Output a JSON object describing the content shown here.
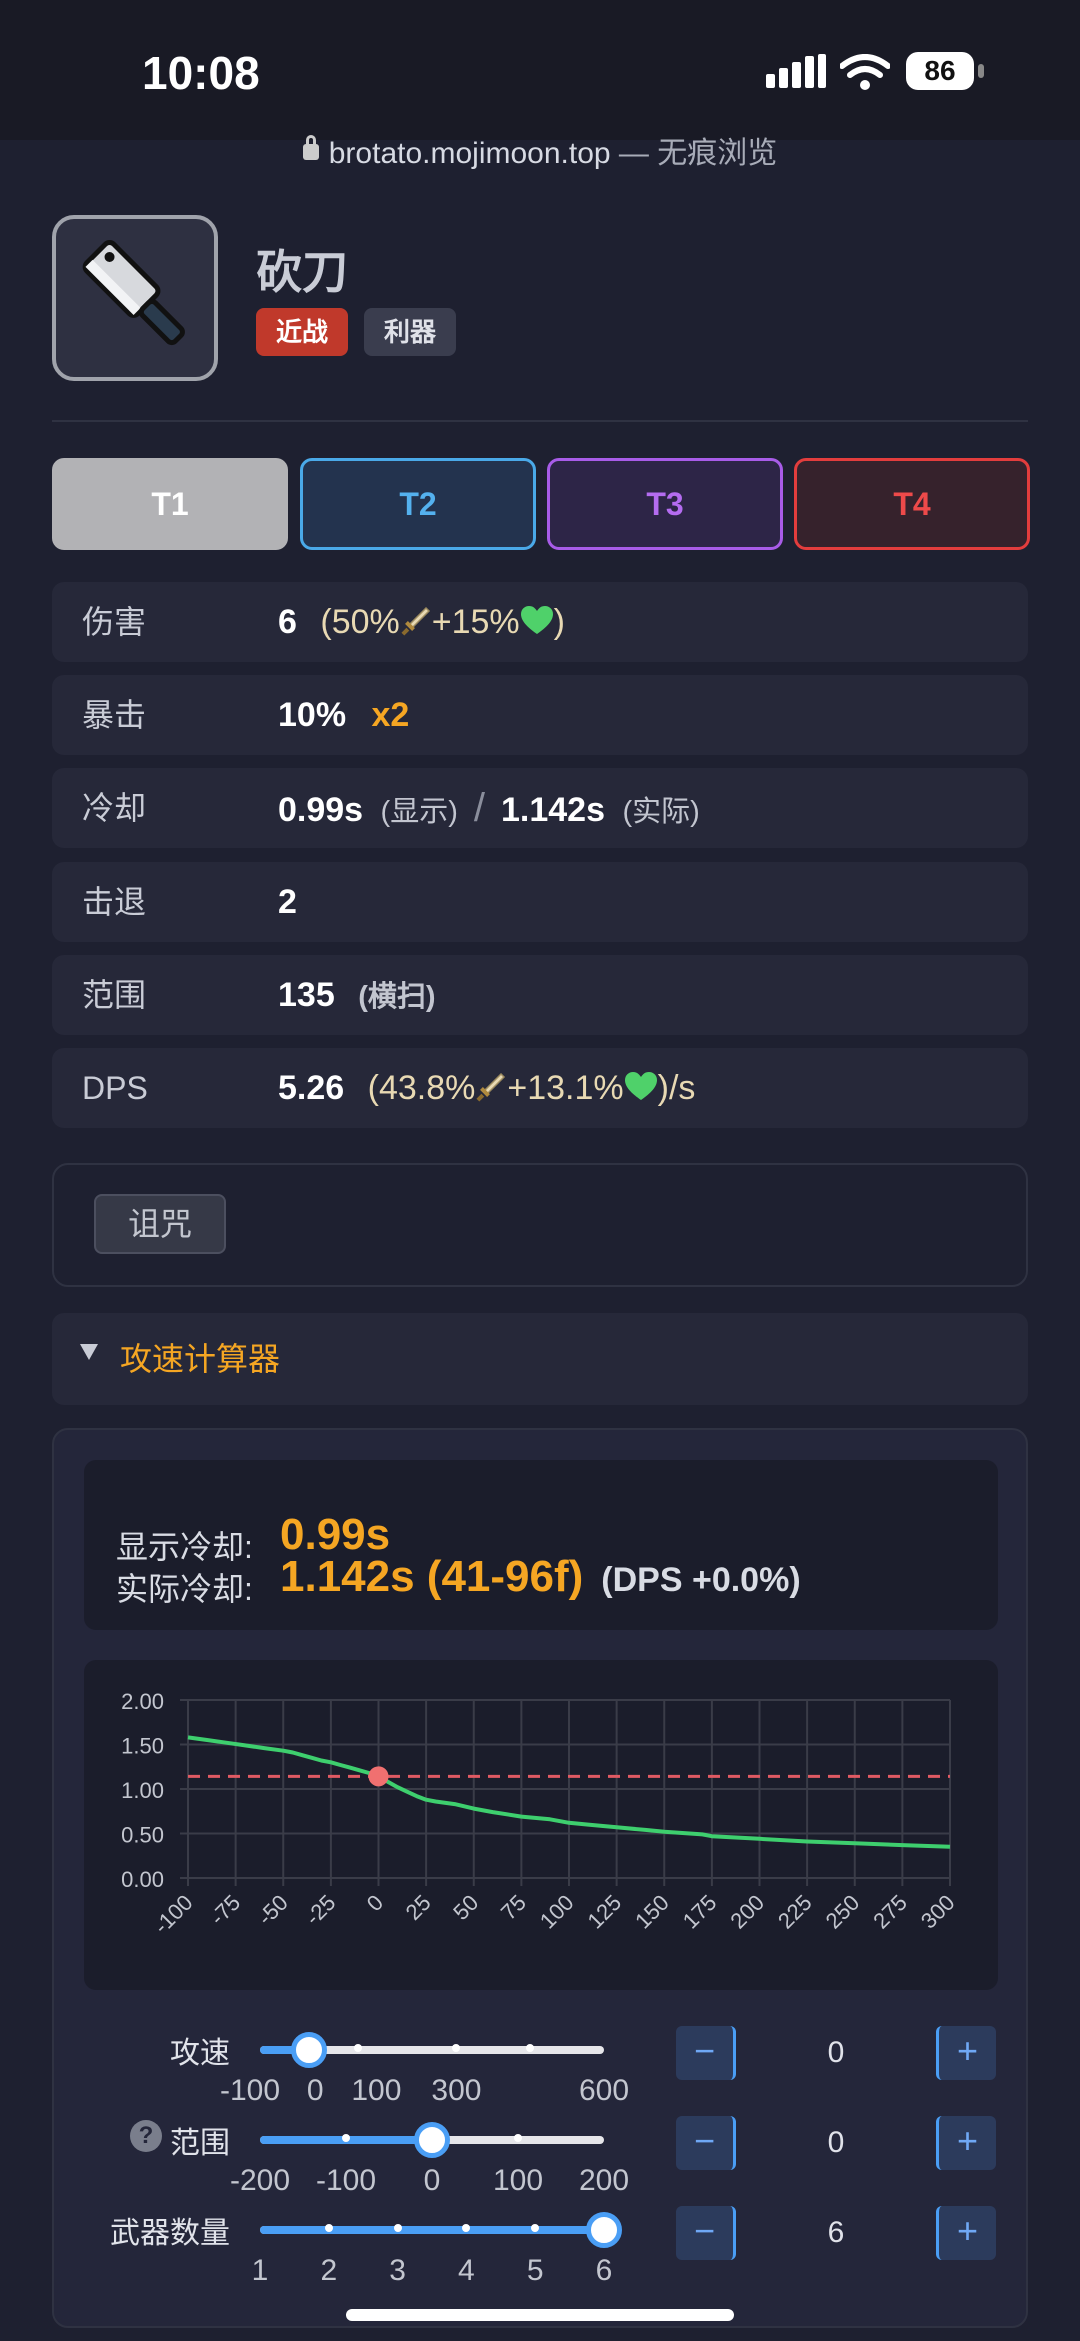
{
  "status": {
    "time": "10:08",
    "battery": "86"
  },
  "browser": {
    "url": "brotato.mojimoon.top",
    "suffix": " — 无痕浏览"
  },
  "weapon": {
    "name": "砍刀",
    "tags": [
      "近战",
      "利器"
    ]
  },
  "tiers": [
    "T1",
    "T2",
    "T3",
    "T4"
  ],
  "stats": {
    "damage": {
      "label": "伤害",
      "value": "6",
      "open": "(50%",
      "plus": "+15%",
      "close": ")"
    },
    "crit": {
      "label": "暴击",
      "value": "10%",
      "mult": "x2"
    },
    "cooldown": {
      "label": "冷却",
      "shown": "0.99s",
      "shown_note": "(显示)",
      "sep": "/",
      "actual": "1.142s",
      "actual_note": "(实际)"
    },
    "knockback": {
      "label": "击退",
      "value": "2"
    },
    "range": {
      "label": "范围",
      "value": "135",
      "note": "(横扫)"
    },
    "dps": {
      "label": "DPS",
      "value": "5.26",
      "open": "(43.8%",
      "plus": "+13.1%",
      "close": ")/s"
    }
  },
  "curse": {
    "label": "诅咒"
  },
  "calculator": {
    "title": "攻速计算器",
    "shown_label": "显示冷却:",
    "shown_value": "0.99s",
    "actual_label": "实际冷却:",
    "actual_value": "1.142s (41-96f)",
    "dps_delta": "(DPS +0.0%)"
  },
  "chart_data": {
    "type": "line",
    "x_ticks": [
      "-100",
      "-75",
      "-50",
      "-25",
      "0",
      "25",
      "50",
      "75",
      "100",
      "125",
      "150",
      "175",
      "200",
      "225",
      "250",
      "275",
      "300"
    ],
    "y_ticks": [
      "2.00",
      "1.50",
      "1.00",
      "0.50",
      "0.00"
    ],
    "xlim": [
      -100,
      300
    ],
    "ylim": [
      0,
      2
    ],
    "grid": true,
    "series_color": "#3ecf6e",
    "reference_line": {
      "y": 1.142,
      "color": "#e05a63"
    },
    "marker": {
      "x": 0,
      "y": 1.142,
      "color": "#f07070"
    },
    "x": [
      -100,
      -90,
      -80,
      -70,
      -60,
      -50,
      -45,
      -40,
      -35,
      -30,
      -25,
      -20,
      -15,
      -10,
      -5,
      0,
      5,
      10,
      15,
      20,
      25,
      30,
      40,
      50,
      60,
      75,
      90,
      100,
      110,
      125,
      140,
      150,
      170,
      175,
      200,
      225,
      250,
      275,
      300
    ],
    "y": [
      1.58,
      1.55,
      1.52,
      1.49,
      1.46,
      1.43,
      1.41,
      1.38,
      1.35,
      1.32,
      1.3,
      1.27,
      1.24,
      1.21,
      1.18,
      1.142,
      1.08,
      1.02,
      0.97,
      0.92,
      0.88,
      0.86,
      0.83,
      0.78,
      0.74,
      0.69,
      0.66,
      0.62,
      0.6,
      0.57,
      0.54,
      0.52,
      0.49,
      0.47,
      0.44,
      0.41,
      0.39,
      0.37,
      0.35
    ]
  },
  "sliders": {
    "attack_speed": {
      "label": "攻速",
      "value": "0",
      "fraction": 0.143,
      "ticks": [
        "-100",
        "0",
        "100",
        "300",
        "600"
      ],
      "dots": [
        0.286,
        0.571,
        0.786
      ]
    },
    "range": {
      "label": "范围",
      "help": "?",
      "value": "0",
      "fraction": 0.5,
      "ticks": [
        "-200",
        "-100",
        "0",
        "100",
        "200"
      ],
      "dots": [
        0.25,
        0.75
      ]
    },
    "weapon_count": {
      "label": "武器数量",
      "value": "6",
      "fraction": 1.0,
      "ticks": [
        "1",
        "2",
        "3",
        "4",
        "5",
        "6"
      ],
      "dots": [
        0.2,
        0.4,
        0.6,
        0.8
      ]
    }
  },
  "stepper": {
    "minus": "−",
    "plus": "+"
  },
  "colors": {
    "accent": "#f5a623",
    "melee": "#c0392b",
    "t2": "#4aa9e8",
    "t3": "#a85ce8",
    "t4": "#e33d3d",
    "slider": "#4a9ef5"
  }
}
